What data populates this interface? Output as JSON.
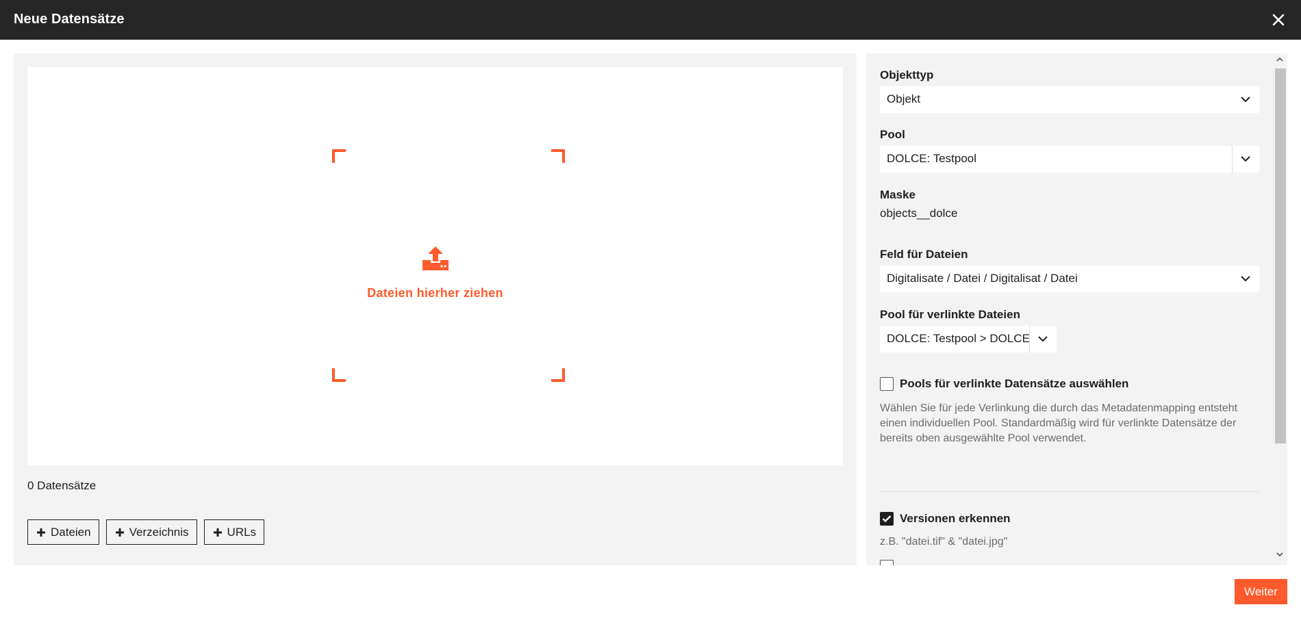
{
  "window": {
    "title": "Neue Datensätze"
  },
  "dropzone": {
    "text": "Dateien hierher ziehen",
    "icon": "upload-icon"
  },
  "records": {
    "count_label": "0 Datensätze"
  },
  "buttons": {
    "files": "Dateien",
    "directory": "Verzeichnis",
    "urls": "URLs"
  },
  "form": {
    "object_type": {
      "label": "Objekttyp",
      "value": "Objekt"
    },
    "pool": {
      "label": "Pool",
      "value": "DOLCE: Testpool"
    },
    "mask": {
      "label": "Maske",
      "value": "objects__dolce"
    },
    "file_field": {
      "label": "Feld für Dateien",
      "value": "Digitalisate / Datei / Digitalisat / Datei"
    },
    "linked_pool": {
      "label": "Pool für verlinkte Dateien",
      "value": "DOLCE: Testpool > DOLCE: I"
    },
    "select_pools": {
      "label": "Pools für verlinkte Datensätze auswählen",
      "checked": false,
      "hint": "Wählen Sie für jede Verlinkung die durch das Metadatenmapping entsteht einen individuellen Pool. Standardmäßig wird für verlinkte Datensätze der bereits oben ausgewählte Pool verwendet."
    },
    "detect_versions": {
      "label": "Versionen erkennen",
      "checked": true,
      "hint": "z.B. \"datei.tif\" & \"datei.jpg\""
    }
  },
  "footer": {
    "next_label": "Weiter"
  },
  "colors": {
    "accent": "#ff5a2c",
    "titlebar": "#262626",
    "panel": "#f3f3f3"
  }
}
